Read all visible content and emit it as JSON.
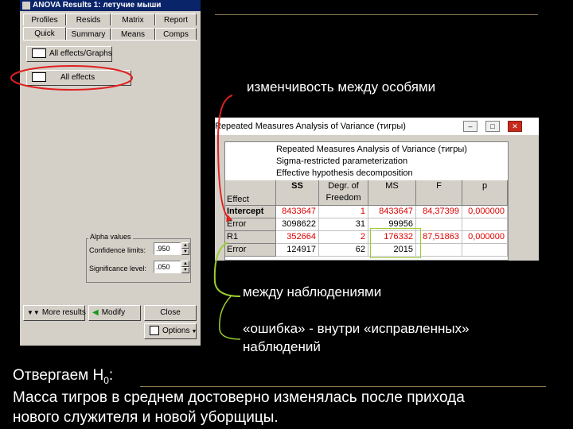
{
  "anova_window": {
    "title": "ANOVA Results 1: летучие мыши",
    "tabs_row1": [
      "Profiles",
      "Resids",
      "Matrix",
      "Report"
    ],
    "tabs_row2": [
      "Quick",
      "Summary",
      "Means",
      "Comps"
    ],
    "buttons": {
      "all_effects_graphs": "All effects/Graphs",
      "all_effects": "All effects"
    },
    "alpha_group": {
      "title": "Alpha values",
      "confidence_label": "Confidence limits:",
      "confidence_value": ".950",
      "significance_label": "Significance level:",
      "significance_value": ".050"
    },
    "bottom_buttons": {
      "more_results": "More results",
      "modify": "Modify",
      "close": "Close",
      "options": "Options"
    }
  },
  "results_window": {
    "title": "Repeated Measures Analysis of Variance (тигры)",
    "title_buttons": [
      "–",
      "□",
      "✕"
    ],
    "header_text": [
      "Repeated Measures Analysis of Variance (тигры)",
      "Sigma-restricted parameterization",
      "Effective hypothesis decomposition"
    ],
    "columns": [
      "Effect",
      "SS",
      "Degr. of Freedom",
      "MS",
      "F",
      "p"
    ],
    "rows": [
      {
        "effect": "Intercept",
        "ss": "8433647",
        "df": "1",
        "ms": "8433647",
        "f": "84,37399",
        "p": "0,000000"
      },
      {
        "effect": "Error",
        "ss": "3098622",
        "df": "31",
        "ms": "99956",
        "f": "",
        "p": ""
      },
      {
        "effect": "R1",
        "ss": "352664",
        "df": "2",
        "ms": "176332",
        "f": "87,51863",
        "p": "0,000000"
      },
      {
        "effect": "Error",
        "ss": "124917",
        "df": "62",
        "ms": "2015",
        "f": "",
        "p": ""
      }
    ]
  },
  "annotations": {
    "between_subjects": "изменчивость между особями",
    "between_observations": "между наблюдениями",
    "error_line1": "«ошибка» - внутри «исправленных»",
    "error_line2": "наблюдений"
  },
  "conclusion": {
    "line1_prefix": "Отвергаем H",
    "line1_sub": "0",
    "line1_suffix": ":",
    "line2": "Масса тигров в среднем достоверно изменялась после прихода",
    "line3": "нового служителя и новой уборщицы."
  },
  "colors": {
    "highlight_circle": "#e02020",
    "red_values": "#dd0000",
    "bracket": "#e02020",
    "green_box": "#9acd32"
  }
}
